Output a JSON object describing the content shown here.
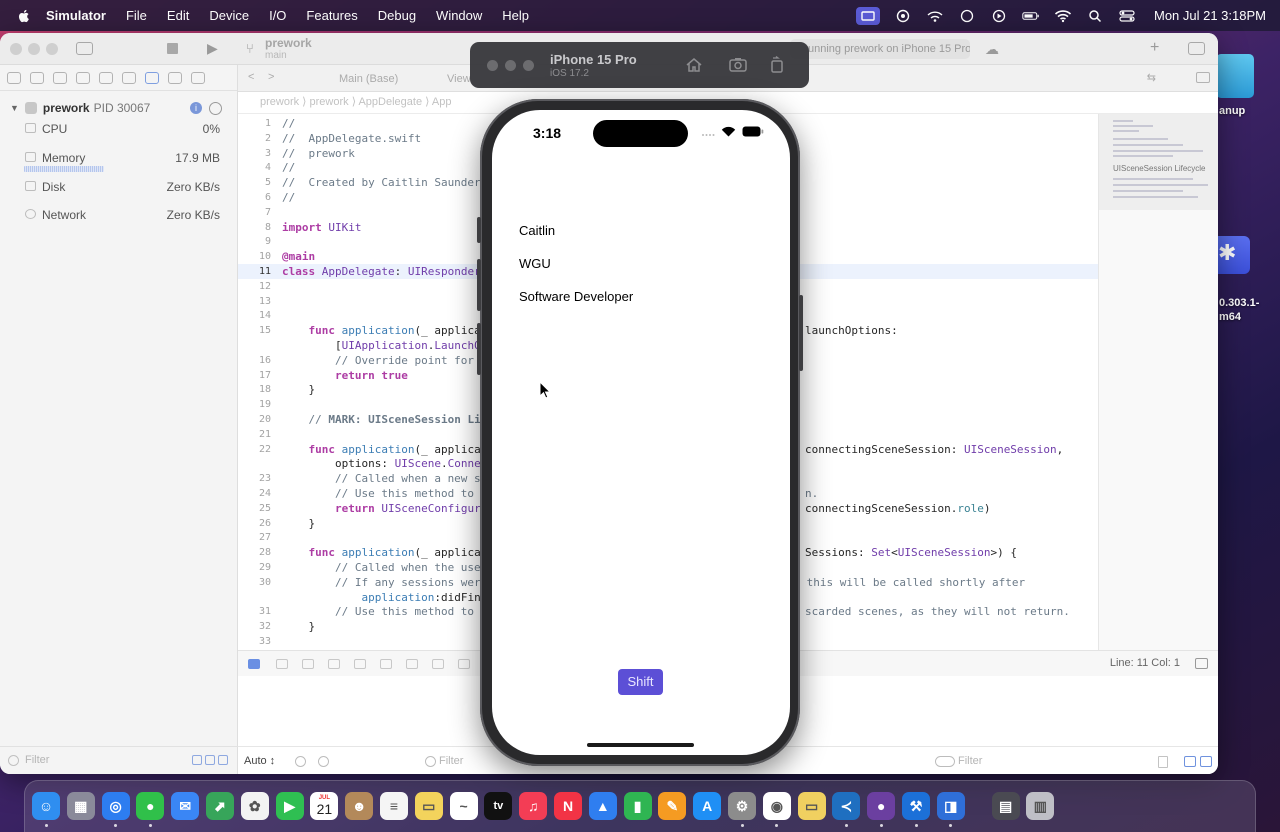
{
  "menubar": {
    "app_name": "Simulator",
    "menus": [
      "File",
      "Edit",
      "Device",
      "I/O",
      "Features",
      "Debug",
      "Window",
      "Help"
    ],
    "clock": "Mon Jul 21  3:18PM"
  },
  "xcode": {
    "scheme_project": "prework",
    "scheme_branch": "main",
    "status_text": "unning prework on iPhone 15 Pro",
    "editor_tabs": {
      "tab1": "Main (Base)",
      "tab2": "View"
    },
    "jumpbar": [
      "prework",
      "prework",
      "AppDelegate",
      "App"
    ],
    "process": {
      "name": "prework",
      "pid": "PID 30067"
    },
    "gauges": [
      {
        "label": "CPU",
        "value": "0%"
      },
      {
        "label": "Memory",
        "value": "17.9 MB"
      },
      {
        "label": "Disk",
        "value": "Zero KB/s"
      },
      {
        "label": "Network",
        "value": "Zero KB/s"
      }
    ],
    "navigator_filter_placeholder": "Filter",
    "code_lines": [
      {
        "n": "1",
        "t": "//"
      },
      {
        "n": "2",
        "t": "//  AppDelegate.swift"
      },
      {
        "n": "3",
        "t": "//  prework"
      },
      {
        "n": "4",
        "t": "//"
      },
      {
        "n": "5",
        "t": "//  Created by Caitlin Saunders"
      },
      {
        "n": "6",
        "t": "//"
      },
      {
        "n": "7",
        "t": ""
      },
      {
        "n": "8",
        "t": "import UIKit"
      },
      {
        "n": "9",
        "t": ""
      },
      {
        "n": "10",
        "t": "@main"
      },
      {
        "n": "11",
        "t": "class AppDelegate: UIResponder"
      },
      {
        "n": "12",
        "t": ""
      },
      {
        "n": "13",
        "t": ""
      },
      {
        "n": "14",
        "t": ""
      },
      {
        "n": "15",
        "t": "    func application(_ applica"
      },
      {
        "n": "",
        "t": "        [UIApplication.LaunchO"
      },
      {
        "n": "16",
        "t": "        // Override point for"
      },
      {
        "n": "17",
        "t": "        return true"
      },
      {
        "n": "18",
        "t": "    }"
      },
      {
        "n": "19",
        "t": ""
      },
      {
        "n": "20",
        "t": "    // MARK: UISceneSession Lif"
      },
      {
        "n": "21",
        "t": ""
      },
      {
        "n": "22",
        "t": "    func application(_ applicat"
      },
      {
        "n": "",
        "t": "        options: UIScene.Connec"
      },
      {
        "n": "23",
        "t": "        // Called when a new sc"
      },
      {
        "n": "24",
        "t": "        // Use this method to s"
      },
      {
        "n": "25",
        "t": "        return UISceneConfigura"
      },
      {
        "n": "26",
        "t": "    }"
      },
      {
        "n": "27",
        "t": ""
      },
      {
        "n": "28",
        "t": "    func application(_ applicat"
      },
      {
        "n": "29",
        "t": "        // Called when the user"
      },
      {
        "n": "30",
        "t": "        // If any sessions were"
      },
      {
        "n": "",
        "t": "            application:didFini"
      },
      {
        "n": "31",
        "t": "        // Use this method to r"
      },
      {
        "n": "32",
        "t": "    }"
      },
      {
        "n": "33",
        "t": ""
      }
    ],
    "code_right_fragments": [
      {
        "line": "15",
        "t": "launchOptions:"
      },
      {
        "line": "22",
        "t": "connectingSceneSession: UISceneSession,"
      },
      {
        "line": "24",
        "t": "n."
      },
      {
        "line": "25",
        "t": "connectingSceneSession.role)"
      },
      {
        "line": "28",
        "t": "Sessions: Set<UISceneSession>) {"
      },
      {
        "line": "30",
        "t": " this will be called shortly after"
      },
      {
        "line": "31",
        "t": "scarded scenes, as they will not return."
      }
    ],
    "minimap_label": "UISceneSession Lifecycle",
    "line_col": "Line: 11  Col: 1",
    "console_auto": "Auto ↕",
    "console_filter_left": "Filter",
    "console_filter_right": "Filter"
  },
  "simulator": {
    "device_name": "iPhone 15 Pro",
    "os_version": "iOS 17.2",
    "status_time": "3:18",
    "labels": [
      "Caitlin",
      "WGU",
      "Software Developer"
    ],
    "button_label": "Shift",
    "button_color": "#5c4fd6"
  },
  "desktop": {
    "item1_label": "anup",
    "item2_label_line1": "0.303.1-",
    "item2_label_line2": "m64"
  },
  "dock": {
    "icons": [
      "finder-icon",
      "launchpad-icon",
      "safari-icon",
      "messages-icon",
      "mail-icon",
      "maps-icon",
      "photos-icon",
      "facetime-icon",
      "calendar-icon",
      "contacts-icon",
      "reminders-icon",
      "notes-icon",
      "freeform-icon",
      "tv-icon",
      "music-icon",
      "news-icon",
      "keynote-icon",
      "numbers-icon",
      "pages-icon",
      "app-store-icon",
      "system-settings-icon",
      "chrome-icon",
      "notes-folder-icon",
      "vscode-icon",
      "github-desktop-icon",
      "xcode-icon",
      "simulator-icon",
      "downloads-icon",
      "trash-icon"
    ],
    "calendar_day": "21",
    "calendar_month": "JUL",
    "tv_label": "tv"
  }
}
